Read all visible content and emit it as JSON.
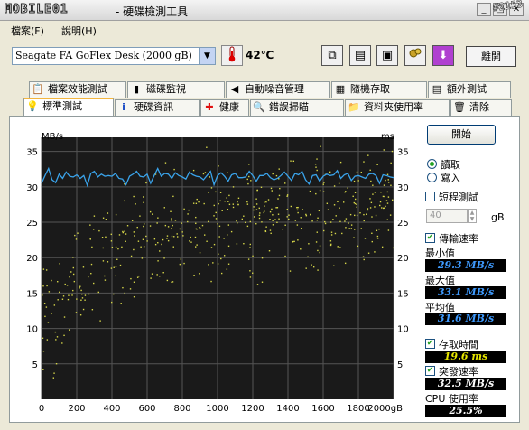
{
  "titlebar": {
    "logo": "MOBILE01",
    "title": "- 硬碟檢測工具",
    "id_badge": "#2153"
  },
  "menu": {
    "file": "檔案(F)",
    "help": "說明(H)"
  },
  "toolbar": {
    "drive": "Seagate FA GoFlex Desk   (2000 gB)",
    "temperature": "42℃",
    "exit": "離開"
  },
  "tabs_top": [
    "檔案效能測試",
    "磁碟監視",
    "自動噪音管理",
    "隨機存取",
    "額外測試"
  ],
  "tabs_bottom": [
    "標準測試",
    "硬碟資訊",
    "健康",
    "錯誤掃瞄",
    "資料夾使用率",
    "清除"
  ],
  "controls": {
    "start": "開始",
    "read": "讀取",
    "write": "寫入",
    "short_test": "短程測試",
    "size_value": "40",
    "size_unit": "gB",
    "transfer_rate": "傳輸速率",
    "min_label": "最小值",
    "min_value": "29.3 MB/s",
    "max_label": "最大值",
    "max_value": "33.1 MB/s",
    "avg_label": "平均值",
    "avg_value": "31.6 MB/s",
    "access_time": "存取時間",
    "access_value": "19.6 ms",
    "burst_rate": "突發速率",
    "burst_value": "32.5 MB/s",
    "cpu_label": "CPU 使用率",
    "cpu_value": "25.5%"
  },
  "chart_data": {
    "type": "line",
    "left_unit": "MB/s",
    "right_unit": "ms",
    "x_ticks": [
      "0",
      "200",
      "400",
      "600",
      "800",
      "1000",
      "1200",
      "1400",
      "1600",
      "1800",
      "2000gB"
    ],
    "y_ticks": [
      "35",
      "30",
      "25",
      "20",
      "15",
      "10",
      "5"
    ],
    "xlim": [
      0,
      2000
    ],
    "ylim": [
      0,
      35
    ],
    "transfer_rate_mbs": {
      "x": [
        0,
        20,
        40,
        60,
        80,
        100,
        120,
        140,
        160,
        180,
        200,
        220,
        240,
        260,
        280,
        300,
        320,
        340,
        360,
        380,
        400,
        420,
        440,
        460,
        480,
        500,
        520,
        540,
        560,
        580,
        600,
        620,
        640,
        660,
        680,
        700,
        720,
        740,
        760,
        780,
        800,
        820,
        840,
        860,
        880,
        900,
        920,
        940,
        960,
        980,
        1000,
        1020,
        1040,
        1060,
        1080,
        1100,
        1120,
        1140,
        1160,
        1180,
        1200,
        1220,
        1240,
        1260,
        1280,
        1300,
        1320,
        1340,
        1360,
        1380,
        1400,
        1420,
        1440,
        1460,
        1480,
        1500,
        1520,
        1540,
        1560,
        1580,
        1600,
        1620,
        1640,
        1660,
        1680,
        1700,
        1720,
        1740,
        1760,
        1780,
        1800,
        1820,
        1840,
        1860,
        1880,
        1900,
        1920,
        1940,
        1960,
        1980,
        2000
      ],
      "y": [
        30.5,
        31.6,
        32.6,
        31.0,
        30.6,
        31.8,
        31.2,
        32.1,
        31.5,
        31.4,
        31.7,
        31.2,
        31.6,
        30.2,
        31.9,
        32.2,
        31.4,
        31.8,
        31.5,
        31.6,
        31.5,
        31.9,
        31.2,
        31.1,
        30.3,
        31.5,
        31.8,
        32.2,
        31.5,
        31.4,
        31.8,
        30.5,
        31.6,
        32.6,
        31.5,
        31.9,
        31.8,
        31.2,
        32.0,
        31.6,
        31.4,
        31.1,
        32.1,
        31.7,
        31.5,
        31.4,
        31.0,
        31.6,
        32.2,
        30.3,
        31.6,
        32.0,
        31.5,
        30.8,
        31.7,
        31.9,
        31.3,
        31.3,
        31.4,
        32.2,
        31.6,
        30.8,
        31.6,
        31.6,
        31.9,
        31.3,
        31.0,
        31.2,
        31.6,
        32.1,
        31.5,
        30.9,
        31.9,
        31.7,
        32.2,
        31.0,
        30.4,
        31.6,
        31.7,
        30.8,
        31.5,
        31.8,
        31.6,
        31.7,
        32.3,
        31.2,
        31.7,
        31.9,
        30.9,
        31.5,
        31.6,
        31.4,
        31.2,
        31.8,
        31.9,
        31.6,
        30.5,
        31.7,
        31.6,
        31.4,
        31.3
      ]
    },
    "access_time_ms": {
      "description": "scatter",
      "trend": [
        [
          0,
          12
        ],
        [
          200,
          16
        ],
        [
          400,
          20
        ],
        [
          600,
          22
        ],
        [
          800,
          24
        ],
        [
          1000,
          25
        ],
        [
          1200,
          25.5
        ],
        [
          1400,
          26
        ],
        [
          1600,
          27
        ],
        [
          1800,
          28
        ],
        [
          2000,
          29
        ]
      ]
    },
    "grid": true
  }
}
